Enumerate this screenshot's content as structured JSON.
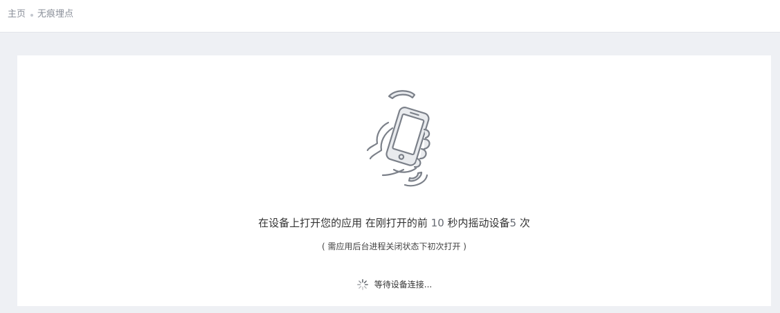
{
  "breadcrumb": {
    "home": "主页",
    "current": "无痕埋点"
  },
  "illustration": {
    "icon": "shake-phone-icon"
  },
  "instruction": {
    "part1": "在设备上打开您的应用 在刚打开的前 ",
    "seconds": "10",
    "part2": " 秒内摇动设备",
    "times": "5",
    "part3": " 次"
  },
  "note": "( 需应用后台进程关闭状态下初次打开 )",
  "status": {
    "icon": "loading-spinner-icon",
    "text": "等待设备连接..."
  },
  "colors": {
    "page_bg": "#eef0f4",
    "card_bg": "#ffffff",
    "icon_stroke": "#7b8089",
    "icon_fill": "#e9ebee",
    "text": "#333333",
    "muted": "#8a8f99"
  }
}
